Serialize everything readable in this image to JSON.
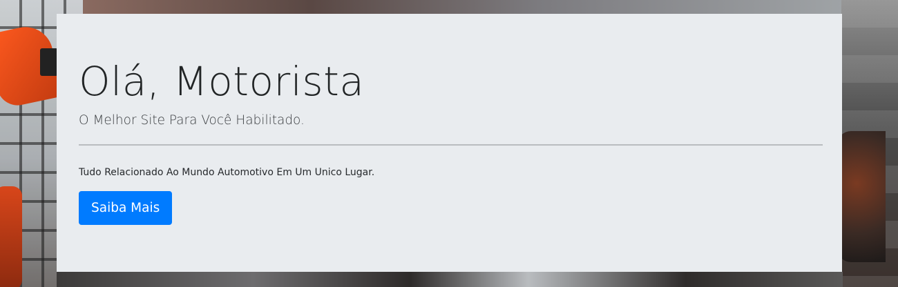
{
  "hero": {
    "title": "Olá, Motorista",
    "subtitle": "O Melhor Site Para Você Habilitado.",
    "description": "Tudo Relacionado Ao Mundo Automotivo Em Um Unico Lugar.",
    "cta_label": "Saiba Mais"
  },
  "colors": {
    "panel_background": "#e9ecef",
    "primary_button": "#007bff",
    "robot_accent": "#ff5a1f"
  }
}
